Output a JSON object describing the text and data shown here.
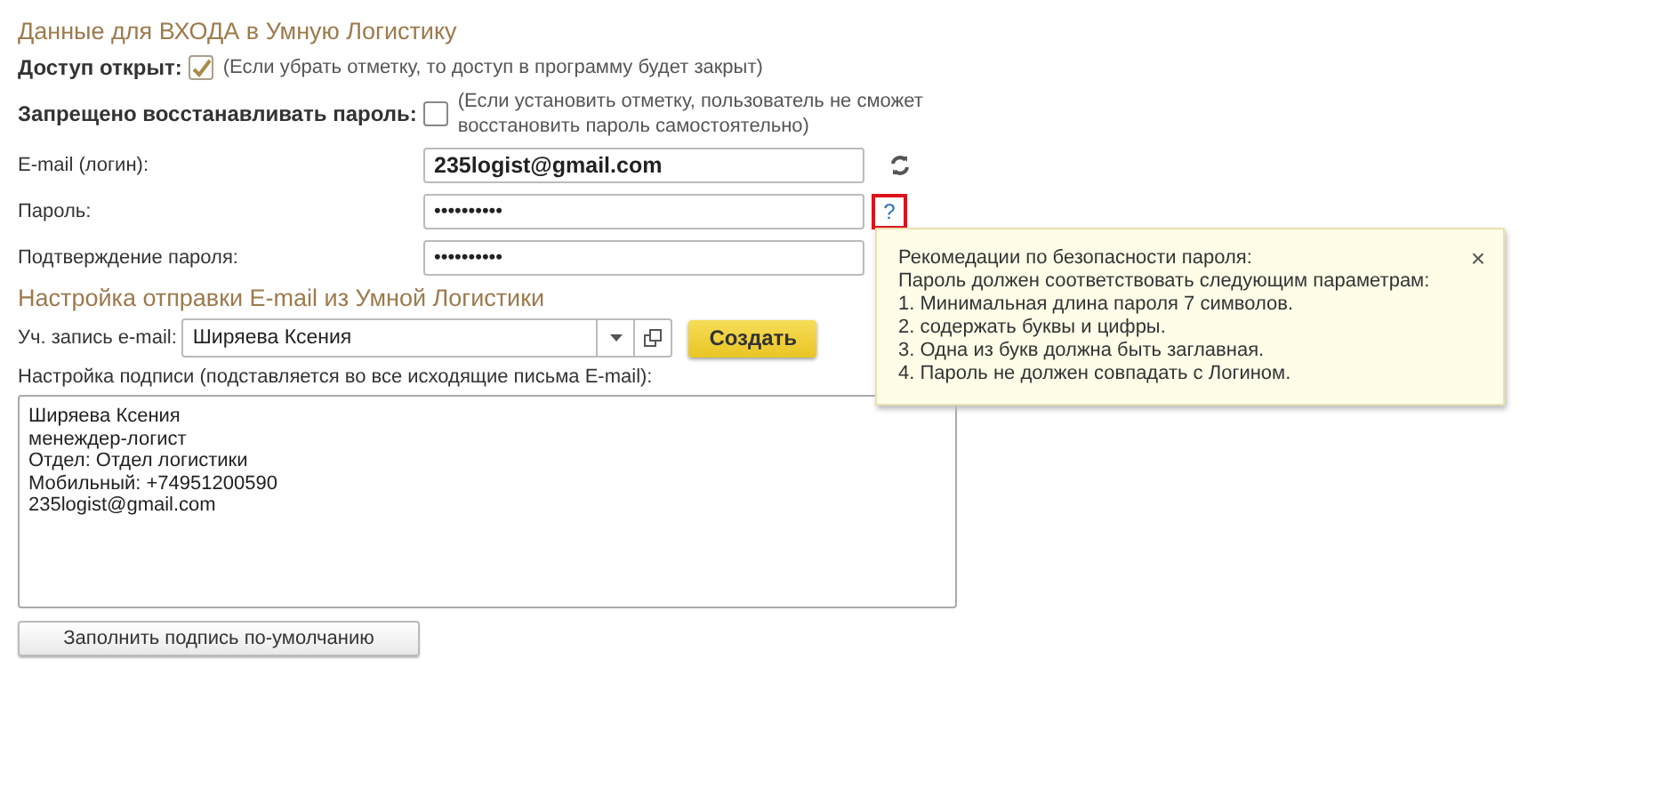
{
  "login_section": {
    "title": "Данные для ВХОДА в Умную Логистику",
    "access": {
      "label": "Доступ открыт:",
      "checked": true,
      "note": "(Если убрать отметку, то доступ в программу будет закрыт)"
    },
    "forbid_restore": {
      "label": "Запрещено восстанавливать пароль:",
      "checked": false,
      "note": "(Если установить отметку, пользователь не сможет восстановить пароль самостоятельно)"
    },
    "fields": [
      {
        "kind": "email",
        "label": "E-mail (логин):",
        "value": "235logist@gmail.com"
      },
      {
        "kind": "password",
        "label": "Пароль:",
        "value": "••••••••••",
        "help": "?"
      },
      {
        "kind": "confirm",
        "label": "Подтверждение пароля:",
        "value": "••••••••••"
      }
    ]
  },
  "email_section": {
    "title": "Настройка отправки E-mail из Умной Логистики",
    "account": {
      "label": "Уч. запись e-mail:",
      "value": "Ширяева Ксения",
      "create_button": "Создать"
    },
    "signature": {
      "label": "Настройка подписи (подставляется во все исходящие письма E-mail):",
      "lines": [
        "Ширяева Ксения",
        "менеждер-логист",
        "Отдел: Отдел логистики",
        "Мобильный: +74951200590",
        "235logist@gmail.com"
      ]
    },
    "fill_button": "Заполнить подпись по-умолчанию"
  },
  "tooltip": {
    "title": "Рекомедации по безопасности пароля:",
    "lines": [
      "Пароль должен соответствовать следующим параметрам:",
      "1. Минимальная длина пароля 7 символов.",
      "2. содержать буквы и цифры.",
      "3. Одна из букв должна быть заглавная.",
      "4. Пароль не должен совпадать с Логином."
    ],
    "close": "×"
  }
}
